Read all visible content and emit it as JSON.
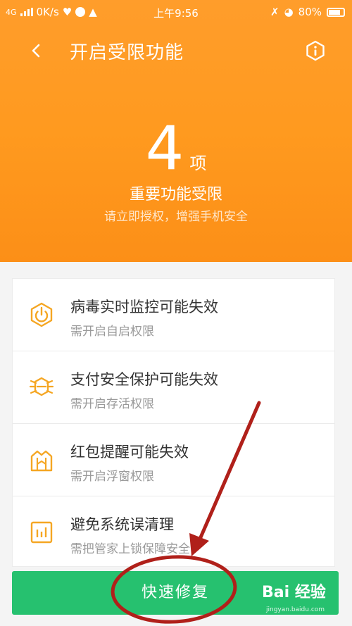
{
  "status_bar": {
    "network": "4G",
    "speed": "0K/s",
    "time": "上午9:56",
    "battery": "80%"
  },
  "header": {
    "title": "开启受限功能",
    "count": "4",
    "count_unit": "项",
    "summary": "重要功能受限",
    "subtitle": "请立即授权，增强手机安全"
  },
  "items": [
    {
      "title": "病毒实时监控可能失效",
      "subtitle": "需开启自启权限",
      "icon": "power-hexagon-icon"
    },
    {
      "title": "支付安全保护可能失效",
      "subtitle": "需开启存活权限",
      "icon": "bug-icon"
    },
    {
      "title": "红包提醒可能失效",
      "subtitle": "需开启浮窗权限",
      "icon": "red-packet-icon"
    },
    {
      "title": "避免系统误清理",
      "subtitle": "需把管家上锁保障安全",
      "icon": "lock-box-icon"
    }
  ],
  "fix_button": {
    "label": "快速修复"
  },
  "watermark": {
    "logo": "Bai 经验",
    "url": "jingyan.baidu.com"
  },
  "colors": {
    "header_orange": "#ff9a1f",
    "accent_icon": "#f5a623",
    "button_green": "#26c16f",
    "annotation_red": "#b0201a"
  }
}
